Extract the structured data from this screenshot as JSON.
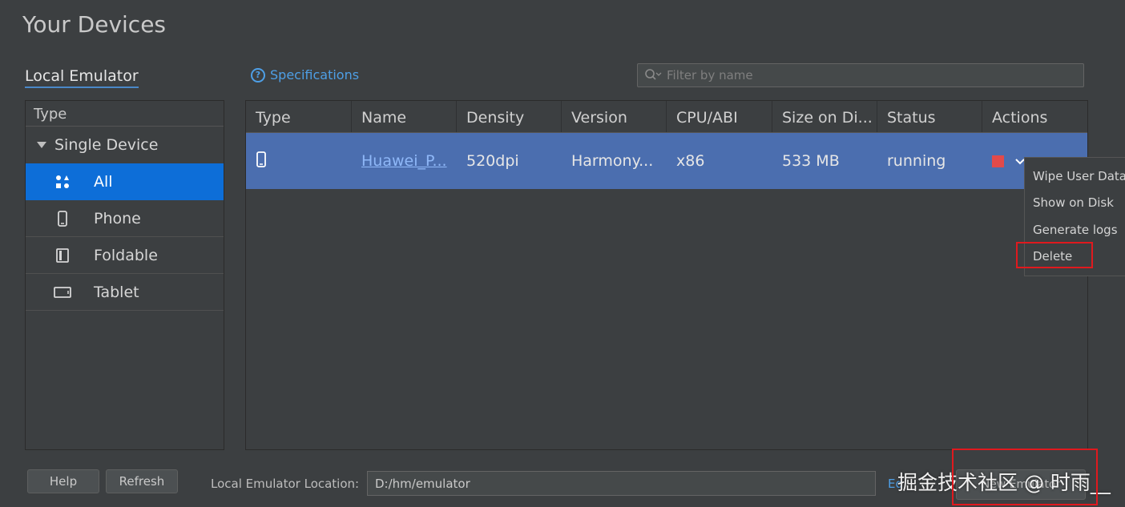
{
  "header": {
    "title": "Your Devices"
  },
  "tabs": {
    "local_emulator": "Local Emulator",
    "specifications": "Specifications"
  },
  "filter": {
    "placeholder": "Filter by name"
  },
  "left_panel": {
    "header": "Type",
    "group": "Single Device",
    "items": [
      {
        "label": "All",
        "icon": "grid-icon",
        "selected": true
      },
      {
        "label": "Phone",
        "icon": "phone-icon"
      },
      {
        "label": "Foldable",
        "icon": "foldable-icon"
      },
      {
        "label": "Tablet",
        "icon": "tablet-icon"
      }
    ]
  },
  "table": {
    "columns": [
      "Type",
      "Name",
      "Density",
      "Version",
      "CPU/ABI",
      "Size on Di...",
      "Status",
      "Actions"
    ],
    "rows": [
      {
        "type_icon": "phone-icon",
        "name": "Huawei_P...",
        "density": "520dpi",
        "version": "Harmony...",
        "cpu": "x86",
        "size": "533 MB",
        "status": "running"
      }
    ]
  },
  "context_menu": {
    "items": [
      "Wipe User Data",
      "Show on Disk",
      "Generate logs",
      "Delete"
    ]
  },
  "footer": {
    "help": "Help",
    "refresh": "Refresh",
    "location_label": "Local Emulator Location:",
    "location_value": "D:/hm/emulator",
    "edit": "Ed",
    "new_emulator": "New Emulator"
  },
  "watermark": "掘金技术社区 @ 时雨__",
  "colors": {
    "accent": "#0d6ed8",
    "row_selected": "#4b6eaf",
    "highlight_box": "#e0191e",
    "stop": "#e24a4a"
  }
}
